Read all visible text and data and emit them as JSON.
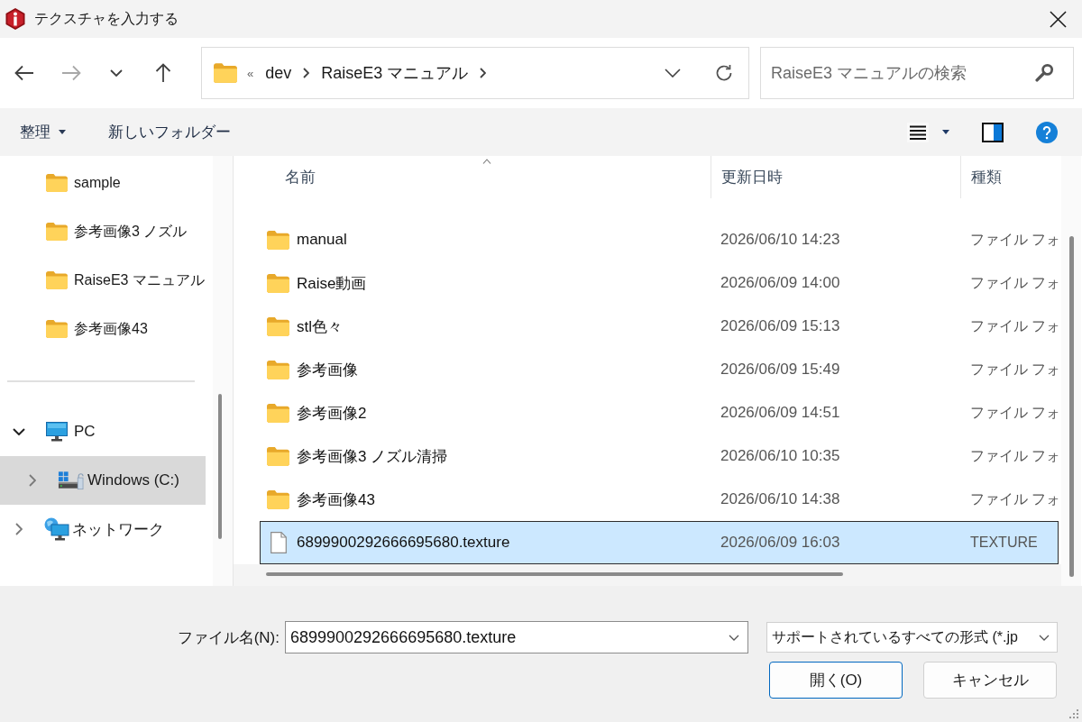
{
  "window": {
    "title": "テクスチャを入力する"
  },
  "nav_buttons": [
    {
      "kind": "back",
      "disabled": false
    },
    {
      "kind": "forward",
      "disabled": true
    },
    {
      "kind": "recent",
      "disabled": false
    },
    {
      "kind": "up",
      "disabled": false
    }
  ],
  "address_bar": {
    "overflow": "«",
    "crumbs": [
      "dev",
      "RaiseE3 マニュアル"
    ]
  },
  "search": {
    "placeholder": "RaiseE3 マニュアルの検索"
  },
  "command_bar": {
    "organize": "整理",
    "new_folder": "新しいフォルダー"
  },
  "nav_pane": {
    "quick_access": [
      {
        "label": "sample",
        "selected": false
      },
      {
        "label": "参考画像3 ノズル",
        "selected": false
      },
      {
        "label": "RaiseE3 マニュアル",
        "selected": false
      },
      {
        "label": "参考画像43",
        "selected": false
      }
    ],
    "tree": [
      {
        "label": "PC",
        "kind": "pc",
        "expanded": true,
        "selected": false,
        "children": [
          {
            "label": "Windows (C:)",
            "kind": "drive",
            "expanded": false,
            "selected": true
          }
        ]
      },
      {
        "label": "ネットワーク",
        "kind": "network",
        "expanded": false,
        "selected": false
      }
    ]
  },
  "file_list": {
    "columns": [
      {
        "label": "名前",
        "sorted": true
      },
      {
        "label": "更新日時",
        "sorted": false
      },
      {
        "label": "種類",
        "sorted": false
      }
    ],
    "rows": [
      {
        "name": "manual",
        "modified": "2026/06/10 14:23",
        "type": "ファイル フォ",
        "kind": "folder",
        "selected": false
      },
      {
        "name": "Raise動画",
        "modified": "2026/06/09 14:00",
        "type": "ファイル フォ",
        "kind": "folder",
        "selected": false
      },
      {
        "name": "stl色々",
        "modified": "2026/06/09 15:13",
        "type": "ファイル フォ",
        "kind": "folder",
        "selected": false
      },
      {
        "name": "参考画像",
        "modified": "2026/06/09 15:49",
        "type": "ファイル フォ",
        "kind": "folder",
        "selected": false
      },
      {
        "name": "参考画像2",
        "modified": "2026/06/09 14:51",
        "type": "ファイル フォ",
        "kind": "folder",
        "selected": false
      },
      {
        "name": "参考画像3 ノズル清掃",
        "modified": "2026/06/10 10:35",
        "type": "ファイル フォ",
        "kind": "folder",
        "selected": false
      },
      {
        "name": "参考画像43",
        "modified": "2026/06/10 14:38",
        "type": "ファイル フォ",
        "kind": "folder",
        "selected": false
      },
      {
        "name": "6899900292666695680.texture",
        "modified": "2026/06/09 16:03",
        "type": "TEXTURE",
        "kind": "file",
        "selected": true
      }
    ]
  },
  "file_name": {
    "label": "ファイル名(N):",
    "value": "6899900292666695680.texture"
  },
  "file_type": {
    "value": "サポートされているすべての形式 (*.jp"
  },
  "buttons": [
    {
      "label": "開く(O)",
      "default": true
    },
    {
      "label": "キャンセル",
      "default": false
    }
  ]
}
